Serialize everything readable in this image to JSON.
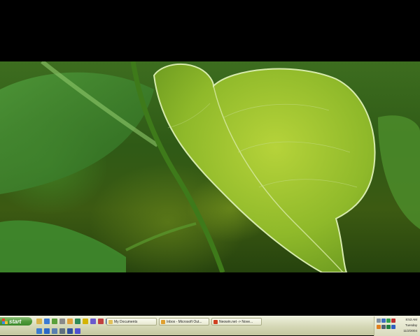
{
  "desktop": {
    "wallpaper": "green-leaf-photo"
  },
  "taskbar": {
    "start_label": "start",
    "quick_launch": [
      {
        "icon": "folder-icon",
        "color": "#d9b44a"
      },
      {
        "icon": "ie-icon",
        "color": "#3b7bd4"
      },
      {
        "icon": "msn-icon",
        "color": "#5aa03a"
      },
      {
        "icon": "calculator-icon",
        "color": "#8a8a8a"
      },
      {
        "icon": "outlook-icon",
        "color": "#e2a23a"
      },
      {
        "icon": "checkmark-icon",
        "color": "#2e8b57"
      },
      {
        "icon": "aim-icon",
        "color": "#d4b400"
      },
      {
        "icon": "media-icon",
        "color": "#6a5acd"
      },
      {
        "icon": "tool-icon",
        "color": "#c04040"
      },
      {
        "icon": "pen-icon",
        "color": "#4060c0"
      },
      {
        "icon": "red-ball-icon",
        "color": "#d03030"
      },
      {
        "icon": "globe-icon",
        "color": "#3a7ad0"
      },
      {
        "icon": "ie-icon",
        "color": "#2c68c8"
      },
      {
        "icon": "window-icon",
        "color": "#5a7fb0"
      },
      {
        "icon": "monitor-icon",
        "color": "#607080"
      },
      {
        "icon": "disk-icon",
        "color": "#3050a0"
      },
      {
        "icon": "media-player-icon",
        "color": "#5050d0"
      }
    ],
    "tasks": [
      {
        "label": "My Documents",
        "icon": "folder-icon",
        "color": "#e2c15a"
      },
      {
        "label": "Inbox - Microsoft Out...",
        "icon": "outlook-icon",
        "color": "#e0a030"
      },
      {
        "label": "Neowin.net -> Nove...",
        "icon": "browser-icon",
        "color": "#d04020"
      }
    ],
    "tray": {
      "icons": [
        {
          "icon": "speaker-icon",
          "color": "#8090a0"
        },
        {
          "icon": "network-icon",
          "color": "#4070c0"
        },
        {
          "icon": "msn-icon",
          "color": "#30a050"
        },
        {
          "icon": "shield-icon",
          "color": "#c03030"
        },
        {
          "icon": "alert-icon",
          "color": "#e08020"
        },
        {
          "icon": "disk-icon",
          "color": "#506070"
        },
        {
          "icon": "chart-icon",
          "color": "#208040"
        },
        {
          "icon": "messenger-icon",
          "color": "#3060c0"
        }
      ],
      "time": "8:53 AM",
      "day": "Tuesday",
      "date": "11/2/2004"
    }
  }
}
